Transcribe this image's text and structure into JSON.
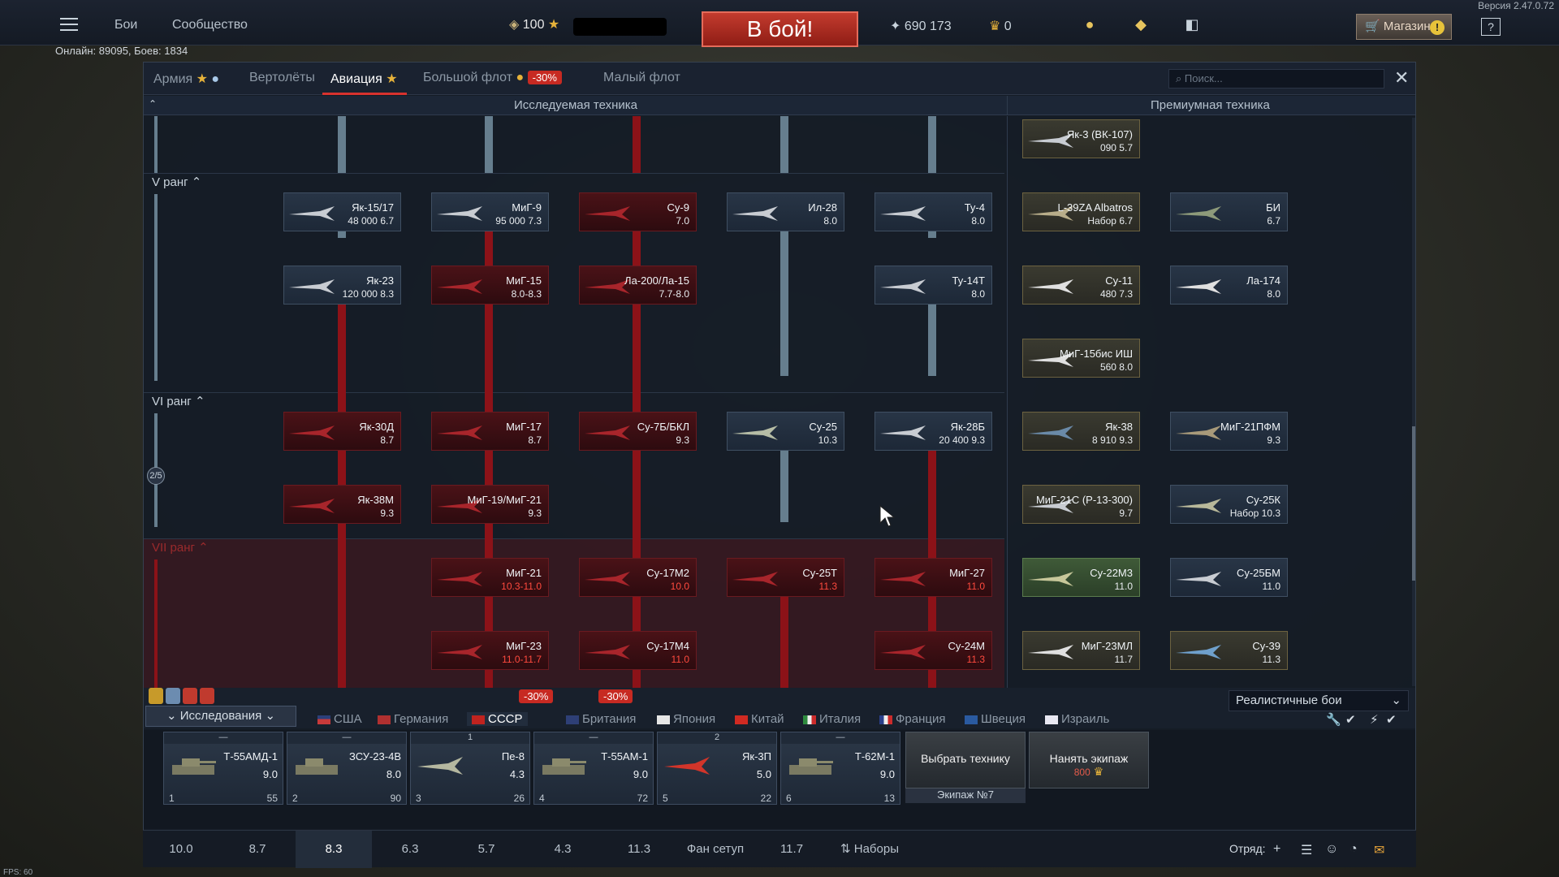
{
  "version": "Версия 2.47.0.72",
  "topbar": {
    "battles": "Бои",
    "community": "Сообщество",
    "lions": "100",
    "battle_button": "В бой!",
    "silver": "690 173",
    "gold": "0",
    "shop": "Магазин",
    "help": "?"
  },
  "online": "Онлайн: 89095, Боев: 1834",
  "tabs": {
    "army": "Армия",
    "heli": "Вертолёты",
    "aviation": "Авиация",
    "bigfleet": "Большой флот",
    "bigfleet_discount": "-30%",
    "smallfleet": "Малый флот"
  },
  "search_placeholder": "Поиск...",
  "sections": {
    "researched": "Исследуемая техника",
    "premium": "Премиумная техника"
  },
  "ranks": {
    "r5": "V ранг",
    "r6": "VI ранг",
    "r7": "VII ранг",
    "progress": "2/5"
  },
  "research_cards": [
    {
      "name": "Як-15/17",
      "br": "48 000 6.7",
      "state": "normal"
    },
    {
      "name": "МиГ-9",
      "br": "95 000 7.3",
      "state": "normal"
    },
    {
      "name": "Су-9",
      "br": "7.0",
      "state": "locked"
    },
    {
      "name": "Ил-28",
      "br": "8.0",
      "state": "normal"
    },
    {
      "name": "Ту-4",
      "br": "8.0",
      "state": "normal"
    },
    {
      "name": "Як-23",
      "br": "120 000 8.3",
      "state": "normal"
    },
    {
      "name": "МиГ-15",
      "br": "8.0-8.3",
      "state": "locked"
    },
    {
      "name": "Ла-200/Ла-15",
      "br": "7.7-8.0",
      "state": "locked"
    },
    {
      "name": "Ту-14Т",
      "br": "8.0",
      "state": "normal"
    },
    {
      "name": "Як-30Д",
      "br": "8.7",
      "state": "locked"
    },
    {
      "name": "МиГ-17",
      "br": "8.7",
      "state": "locked"
    },
    {
      "name": "Су-7Б/БКЛ",
      "br": "9.3",
      "state": "locked"
    },
    {
      "name": "Су-25",
      "br": "10.3",
      "state": "normal"
    },
    {
      "name": "Як-28Б",
      "br": "20 400 9.3",
      "state": "normal"
    },
    {
      "name": "Як-38М",
      "br": "9.3",
      "state": "locked"
    },
    {
      "name": "МиГ-19/МиГ-21",
      "br": "9.3",
      "state": "locked"
    },
    {
      "name": "МиГ-21",
      "br": "10.3-11.0",
      "state": "locked",
      "red": true
    },
    {
      "name": "Су-17М2",
      "br": "10.0",
      "state": "locked",
      "red": true
    },
    {
      "name": "Су-25Т",
      "br": "11.3",
      "state": "locked",
      "red": true
    },
    {
      "name": "МиГ-27",
      "br": "11.0",
      "state": "locked",
      "red": true
    },
    {
      "name": "МиГ-23",
      "br": "11.0-11.7",
      "state": "locked",
      "red": true
    },
    {
      "name": "Су-17М4",
      "br": "11.0",
      "state": "locked",
      "red": true
    },
    {
      "name": "Су-24М",
      "br": "11.3",
      "state": "locked",
      "red": true
    }
  ],
  "premium_cards": [
    {
      "name": "Як-3 (ВК-107)",
      "br": "090 5.7"
    },
    {
      "name": "L-39ZA Albatros",
      "br": "Набор 6.7"
    },
    {
      "name": "БИ",
      "br": "6.7"
    },
    {
      "name": "Су-11",
      "br": "480 7.3"
    },
    {
      "name": "Ла-174",
      "br": "8.0"
    },
    {
      "name": "МиГ-15бис ИШ",
      "br": "560 8.0"
    },
    {
      "name": "Як-38",
      "br": "8 910 9.3"
    },
    {
      "name": "МиГ-21ПФМ",
      "br": "9.3"
    },
    {
      "name": "МиГ-21С (Р-13-300)",
      "br": "9.7"
    },
    {
      "name": "Су-25К",
      "br": "Набор 10.3"
    },
    {
      "name": "Су-22М3",
      "br": "11.0"
    },
    {
      "name": "Су-25БМ",
      "br": "11.0"
    },
    {
      "name": "МиГ-23МЛ",
      "br": "11.7"
    },
    {
      "name": "Су-39",
      "br": "11.3"
    }
  ],
  "research_button": "Исследования",
  "game_mode": "Реалистичные бои",
  "nations": [
    {
      "name": "США"
    },
    {
      "name": "Германия"
    },
    {
      "name": "СССР"
    },
    {
      "name": "Британия"
    },
    {
      "name": "Япония"
    },
    {
      "name": "Китай"
    },
    {
      "name": "Италия"
    },
    {
      "name": "Франция"
    },
    {
      "name": "Швеция"
    },
    {
      "name": "Израиль"
    }
  ],
  "nation_discount_1": "-30%",
  "nation_discount_2": "-30%",
  "slots": [
    {
      "name": "Т-55АМД-1",
      "br": "9.0",
      "num": "1",
      "extra": "55"
    },
    {
      "name": "ЗСУ-23-4В",
      "br": "8.0",
      "num": "2",
      "extra": "90"
    },
    {
      "name": "Пе-8",
      "br": "4.3",
      "num": "3",
      "extra": "26",
      "top": "1"
    },
    {
      "name": "Т-55АМ-1",
      "br": "9.0",
      "num": "4",
      "extra": "72"
    },
    {
      "name": "Як-3П",
      "br": "5.0",
      "num": "5",
      "extra": "22",
      "top": "2"
    },
    {
      "name": "Т-62М-1",
      "br": "9.0",
      "num": "6",
      "extra": "13"
    }
  ],
  "choose_vehicle": "Выбрать технику",
  "hire_crew": "Нанять экипаж",
  "hire_cost": "800",
  "crew_label": "Экипаж №7",
  "presets": [
    "10.0",
    "8.7",
    "8.3",
    "6.3",
    "5.7",
    "4.3",
    "11.3",
    "Фан сетуп",
    "11.7",
    "Наборы"
  ],
  "squad": "Отряд:",
  "fps": "FPS: 60",
  "colors": {
    "accent_red": "#c72a22",
    "tree_line": "#667e8e",
    "locked": "#4a1217"
  }
}
